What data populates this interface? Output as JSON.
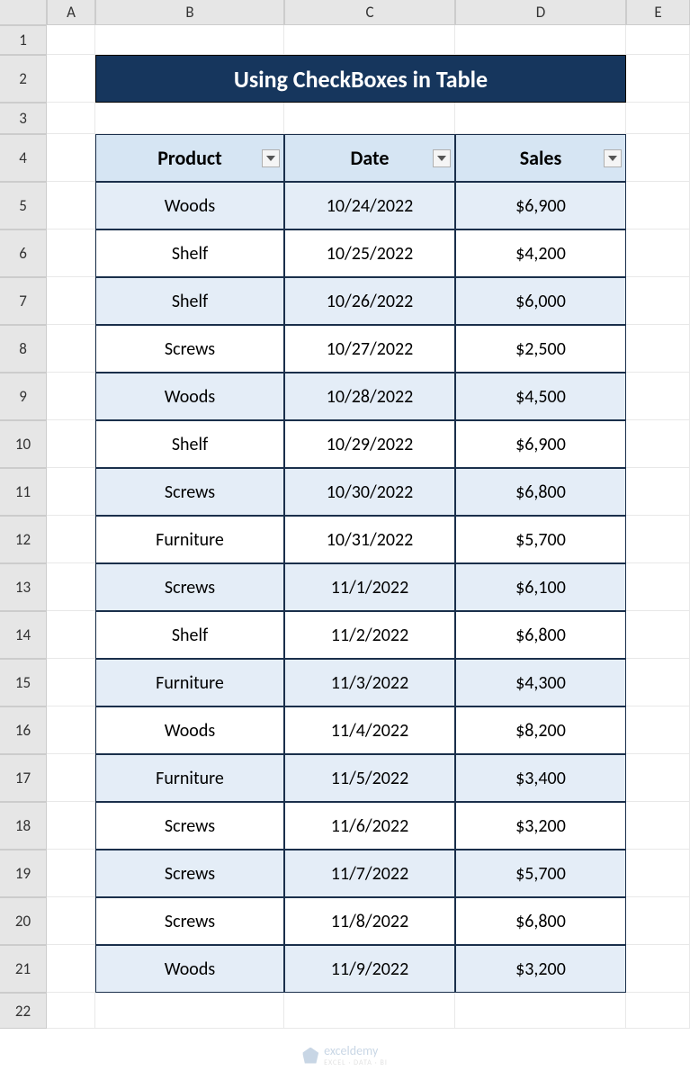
{
  "columns": [
    "A",
    "B",
    "C",
    "D",
    "E"
  ],
  "row_numbers": [
    1,
    2,
    3,
    4,
    5,
    6,
    7,
    8,
    9,
    10,
    11,
    12,
    13,
    14,
    15,
    16,
    17,
    18,
    19,
    20,
    21,
    22
  ],
  "title": "Using CheckBoxes in Table",
  "headers": {
    "product": "Product",
    "date": "Date",
    "sales": "Sales"
  },
  "rows": [
    {
      "product": "Woods",
      "date": "10/24/2022",
      "sales": "$6,900"
    },
    {
      "product": "Shelf",
      "date": "10/25/2022",
      "sales": "$4,200"
    },
    {
      "product": "Shelf",
      "date": "10/26/2022",
      "sales": "$6,000"
    },
    {
      "product": "Screws",
      "date": "10/27/2022",
      "sales": "$2,500"
    },
    {
      "product": "Woods",
      "date": "10/28/2022",
      "sales": "$4,500"
    },
    {
      "product": "Shelf",
      "date": "10/29/2022",
      "sales": "$6,900"
    },
    {
      "product": "Screws",
      "date": "10/30/2022",
      "sales": "$6,800"
    },
    {
      "product": "Furniture",
      "date": "10/31/2022",
      "sales": "$5,700"
    },
    {
      "product": "Screws",
      "date": "11/1/2022",
      "sales": "$6,100"
    },
    {
      "product": "Shelf",
      "date": "11/2/2022",
      "sales": "$6,800"
    },
    {
      "product": "Furniture",
      "date": "11/3/2022",
      "sales": "$4,300"
    },
    {
      "product": "Woods",
      "date": "11/4/2022",
      "sales": "$8,200"
    },
    {
      "product": "Furniture",
      "date": "11/5/2022",
      "sales": "$3,400"
    },
    {
      "product": "Screws",
      "date": "11/6/2022",
      "sales": "$3,200"
    },
    {
      "product": "Screws",
      "date": "11/7/2022",
      "sales": "$5,700"
    },
    {
      "product": "Screws",
      "date": "11/8/2022",
      "sales": "$6,800"
    },
    {
      "product": "Woods",
      "date": "11/9/2022",
      "sales": "$3,200"
    }
  ],
  "watermark": {
    "brand": "exceldemy",
    "tag": "EXCEL · DATA · BI"
  }
}
